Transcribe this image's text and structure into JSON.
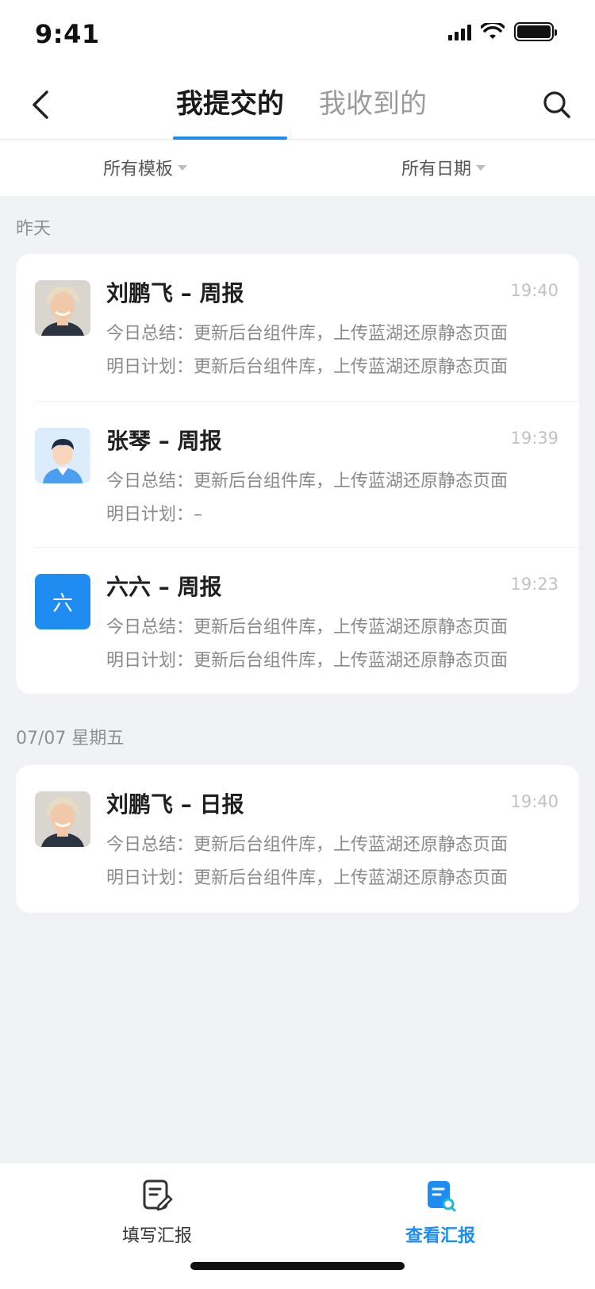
{
  "status": {
    "time": "9:41"
  },
  "nav": {
    "tabs": [
      "我提交的",
      "我收到的"
    ],
    "active_tab": 0
  },
  "filters": {
    "template": "所有模板",
    "date": "所有日期"
  },
  "sections": [
    {
      "label": "昨天",
      "items": [
        {
          "title": "刘鹏飞 – 周报",
          "time": "19:40",
          "summary": "今日总结：更新后台组件库，上传蓝湖还原静态页面",
          "plan": "明日计划：更新后台组件库，上传蓝湖还原静态页面",
          "avatar": "photo-woman-icon"
        },
        {
          "title": "张琴 – 周报",
          "time": "19:39",
          "summary": "今日总结：更新后台组件库，上传蓝湖还原静态页面",
          "plan": "明日计划：–",
          "avatar": "person-icon"
        },
        {
          "title": "六六 – 周报",
          "time": "19:23",
          "summary": "今日总结：更新后台组件库，上传蓝湖还原静态页面",
          "plan": "明日计划：更新后台组件库，上传蓝湖还原静态页面",
          "avatar_text": "六"
        }
      ]
    },
    {
      "label": "07/07 星期五",
      "items": [
        {
          "title": "刘鹏飞 – 日报",
          "time": "19:40",
          "summary": "今日总结：更新后台组件库，上传蓝湖还原静态页面",
          "plan": "明日计划：更新后台组件库，上传蓝湖还原静态页面",
          "avatar": "photo-woman-icon"
        }
      ]
    }
  ],
  "tabbar": {
    "write": "填写汇报",
    "view": "查看汇报",
    "active": "view"
  },
  "colors": {
    "accent": "#1e8cf0",
    "background": "#f0f2f5"
  }
}
